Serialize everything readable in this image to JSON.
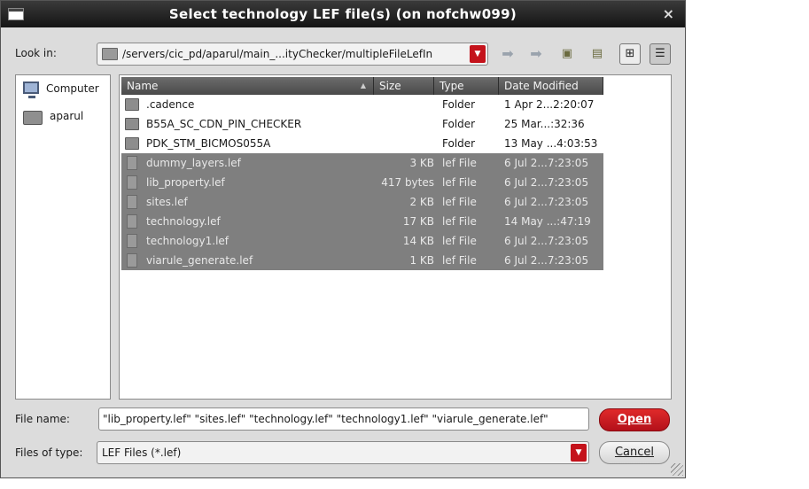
{
  "window": {
    "title": "Select technology LEF file(s) (on nofchw099)",
    "close_glyph": "×"
  },
  "lookin": {
    "label": "Look in:",
    "path": "/servers/cic_pd/aparul/main_...ityChecker/multipleFileLefIn"
  },
  "toolbar": {
    "back_icon": "back-arrow-icon",
    "forward_icon": "forward-arrow-icon",
    "parent_icon": "parent-folder-icon",
    "new_folder_icon": "new-folder-icon",
    "list_view_icon": "list-view-icon",
    "detail_view_icon": "detail-view-icon"
  },
  "sidebar": {
    "items": [
      {
        "label": "Computer",
        "icon": "computer-icon"
      },
      {
        "label": "aparul",
        "icon": "folder-icon"
      }
    ]
  },
  "filelist": {
    "columns": [
      "Name",
      "Size",
      "Type",
      "Date Modified"
    ],
    "rows": [
      {
        "name": ".cadence",
        "size": "",
        "type": "Folder",
        "date": "1 Apr 2...2:20:07",
        "kind": "folder",
        "selected": false
      },
      {
        "name": "B55A_SC_CDN_PIN_CHECKER",
        "size": "",
        "type": "Folder",
        "date": "25 Mar...:32:36",
        "kind": "folder",
        "selected": false
      },
      {
        "name": "PDK_STM_BICMOS055A",
        "size": "",
        "type": "Folder",
        "date": "13 May ...4:03:53",
        "kind": "folder",
        "selected": false
      },
      {
        "name": "dummy_layers.lef",
        "size": "3 KB",
        "type": "lef File",
        "date": "6 Jul 2...7:23:05",
        "kind": "file",
        "selected": true
      },
      {
        "name": "lib_property.lef",
        "size": "417 bytes",
        "type": "lef File",
        "date": "6 Jul 2...7:23:05",
        "kind": "file",
        "selected": true
      },
      {
        "name": "sites.lef",
        "size": "2 KB",
        "type": "lef File",
        "date": "6 Jul 2...7:23:05",
        "kind": "file",
        "selected": true
      },
      {
        "name": "technology.lef",
        "size": "17 KB",
        "type": "lef File",
        "date": "14 May ...:47:19",
        "kind": "file",
        "selected": true
      },
      {
        "name": "technology1.lef",
        "size": "14 KB",
        "type": "lef File",
        "date": "6 Jul 2...7:23:05",
        "kind": "file",
        "selected": true
      },
      {
        "name": "viarule_generate.lef",
        "size": "1 KB",
        "type": "lef File",
        "date": "6 Jul 2...7:23:05",
        "kind": "file",
        "selected": true
      }
    ]
  },
  "filename": {
    "label": "File name:",
    "value": "\"lib_property.lef\" \"sites.lef\" \"technology.lef\" \"technology1.lef\" \"viarule_generate.lef\""
  },
  "filetype": {
    "label": "Files of type:",
    "value": "LEF Files (*.lef)"
  },
  "buttons": {
    "open": "Open",
    "cancel": "Cancel"
  },
  "colors": {
    "accent_red": "#c4121b",
    "selection_gray": "#7f7f7f",
    "titlebar": "#1e1e1e"
  }
}
